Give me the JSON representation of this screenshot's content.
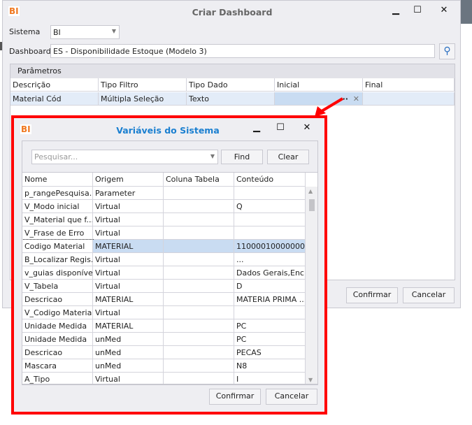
{
  "main": {
    "title": "Criar Dashboard",
    "logo": "BI",
    "sistema_label": "Sistema",
    "sistema_value": "BI",
    "dashboard_label": "Dashboard",
    "dashboard_value": "ES - Disponibilidade Estoque (Modelo 3)",
    "group_title": "Parâmetros",
    "columns": [
      "Descrição",
      "Tipo Filtro",
      "Tipo Dado",
      "Inicial",
      "Final"
    ],
    "row": [
      "Material Cód",
      "Múltipla Seleção",
      "Texto",
      "",
      ""
    ],
    "ellipsis": "···",
    "clear_x": "✕",
    "confirm": "Confirmar",
    "cancel": "Cancelar"
  },
  "popup": {
    "title": "Variáveis do Sistema",
    "logo": "BI",
    "search_placeholder": "Pesquisar...",
    "find": "Find",
    "clear": "Clear",
    "columns": [
      "Nome",
      "Origem",
      "Coluna Tabela",
      "Conteúdo"
    ],
    "rows": [
      [
        "p_rangePesquisa...",
        "Parameter",
        "",
        ""
      ],
      [
        "V_Modo inicial",
        "Virtual",
        "",
        "Q"
      ],
      [
        "V_Material que f...",
        "Virtual",
        "",
        ""
      ],
      [
        "V_Frase de Erro",
        "Virtual",
        "",
        ""
      ],
      [
        "Codigo Material",
        "MATERIAL",
        "",
        "11000010000000..."
      ],
      [
        "B_Localizar Regis...",
        "Virtual",
        "",
        "..."
      ],
      [
        "v_guias disponíveis",
        "Virtual",
        "",
        "Dados Gerais,Enc..."
      ],
      [
        "V_Tabela",
        "Virtual",
        "",
        "D"
      ],
      [
        "Descricao",
        "MATERIAL",
        "",
        "MATERIA PRIMA ..."
      ],
      [
        "V_Codigo Materia...",
        "Virtual",
        "",
        ""
      ],
      [
        "Unidade Medida",
        "MATERIAL",
        "",
        "PC"
      ],
      [
        "Unidade Medida",
        "unMed",
        "",
        "PC"
      ],
      [
        "Descricao",
        "unMed",
        "",
        "PECAS"
      ],
      [
        "Mascara",
        "unMed",
        "",
        "N8"
      ],
      [
        "A_Tipo",
        "Virtual",
        "",
        "I"
      ]
    ],
    "selected_row": 4,
    "confirm": "Confirmar",
    "cancel": "Cancelar"
  },
  "colors": {
    "selection": "#c9dcf2",
    "highlight": "#ff0000",
    "popup_title": "#1a7fd0",
    "logo": "#f07820"
  }
}
